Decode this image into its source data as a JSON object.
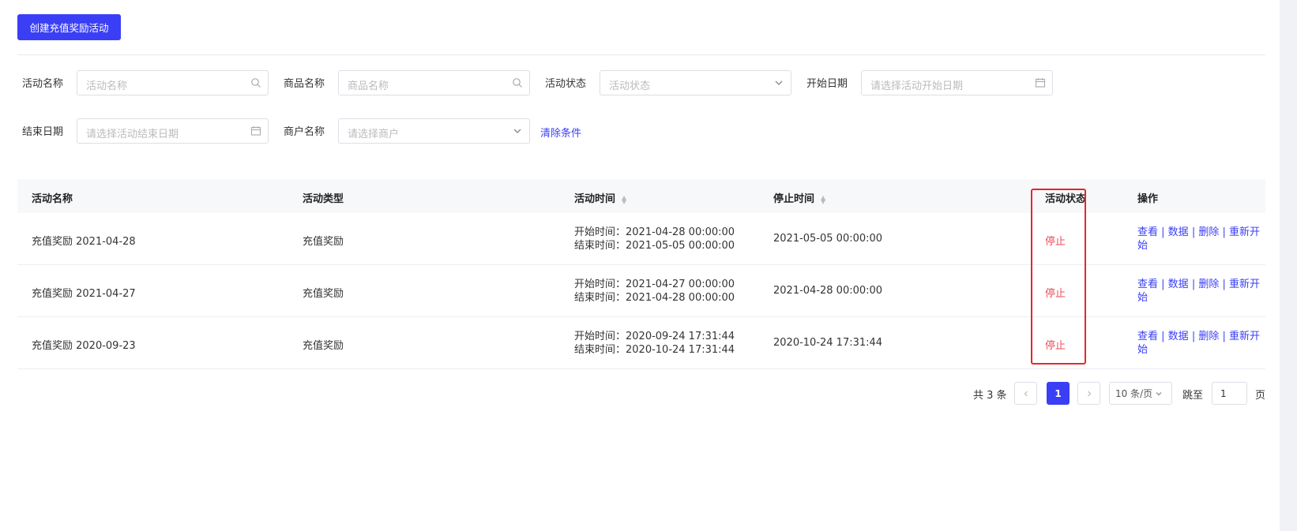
{
  "toolbar": {
    "create_label": "创建充值奖励活动"
  },
  "filters": {
    "activity_name_label": "活动名称",
    "activity_name_placeholder": "活动名称",
    "product_name_label": "商品名称",
    "product_name_placeholder": "商品名称",
    "activity_status_label": "活动状态",
    "activity_status_placeholder": "活动状态",
    "start_date_label": "开始日期",
    "start_date_placeholder": "请选择活动开始日期",
    "end_date_label": "结束日期",
    "end_date_placeholder": "请选择活动结束日期",
    "merchant_label": "商户名称",
    "merchant_placeholder": "请选择商户",
    "clear_label": "清除条件"
  },
  "table": {
    "headers": [
      "活动名称",
      "活动类型",
      "活动时间",
      "停止时间",
      "活动状态",
      "操作"
    ],
    "start_prefix": "开始时间：",
    "end_prefix": "结束时间：",
    "rows": [
      {
        "name": "充值奖励 2021-04-28",
        "type": "充值奖励",
        "start": "开始时间：2021-04-28 00:00:00",
        "end": "结束时间：2021-05-05 00:00:00",
        "stop": "2021-05-05 00:00:00",
        "status": "停止"
      },
      {
        "name": "充值奖励 2021-04-27",
        "type": "充值奖励",
        "start": "开始时间：2021-04-27 00:00:00",
        "end": "结束时间：2021-04-28 00:00:00",
        "stop": "2021-04-28 00:00:00",
        "status": "停止"
      },
      {
        "name": "充值奖励 2020-09-23",
        "type": "充值奖励",
        "start": "开始时间：2020-09-24 17:31:44",
        "end": "结束时间：2020-10-24 17:31:44",
        "stop": "2020-10-24 17:31:44",
        "status": "停止"
      }
    ],
    "ops": {
      "view": "查看",
      "data": "数据",
      "delete": "删除",
      "restart": "重新开始",
      "sep": " | "
    }
  },
  "pagination": {
    "total": "共 3 条",
    "current_page": "1",
    "page_size": "10 条/页",
    "goto_label": "跳至",
    "goto_value": "1",
    "page_suffix": "页"
  },
  "colors": {
    "primary": "#3a3ff5",
    "danger": "#f04b5a",
    "highlight": "#e8252c"
  }
}
